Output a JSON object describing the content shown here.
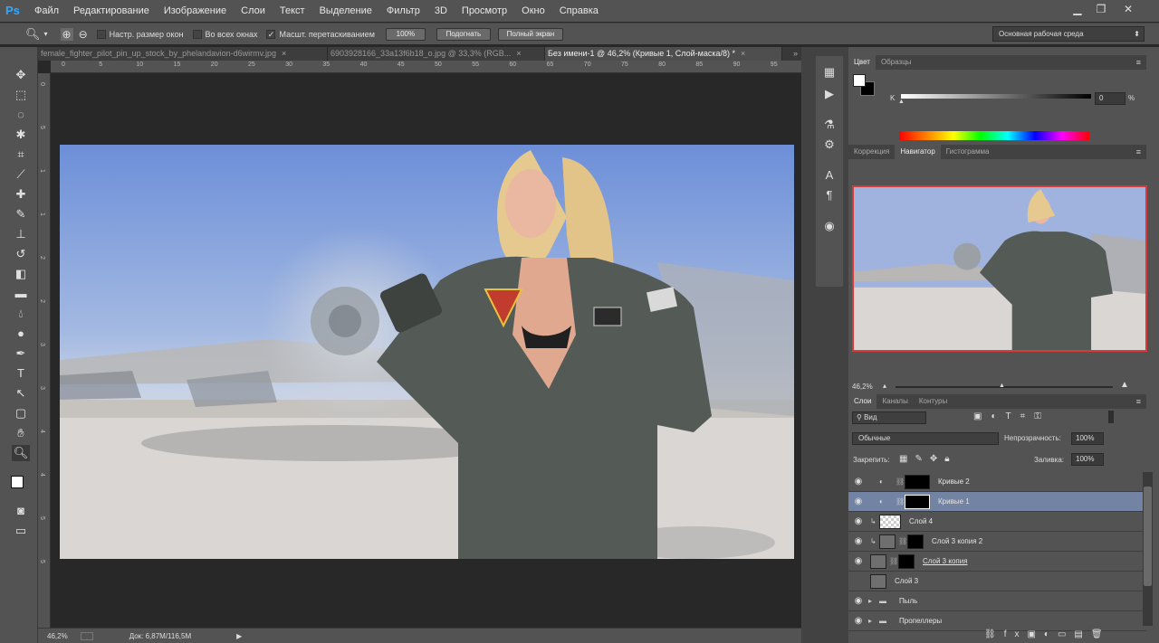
{
  "app": {
    "logo": "Ps"
  },
  "menu": [
    "Файл",
    "Редактирование",
    "Изображение",
    "Слои",
    "Текст",
    "Выделение",
    "Фильтр",
    "3D",
    "Просмотр",
    "Окно",
    "Справка"
  ],
  "options": {
    "resize_windows": "Настр. размер окон",
    "all_windows": "Во всех окнах",
    "scrubby_zoom": "Масшт. перетаскиванием",
    "zoom_100": "100%",
    "fit": "Подогнать",
    "full_screen": "Полный экран",
    "workspace": "Основная рабочая среда"
  },
  "tabs": [
    {
      "label": "female_fighter_pilot_pin_up_stock_by_phelandavion-d6wirmv.jpg"
    },
    {
      "label": "6903928166_33a13f6b18_o.jpg @ 33,3% (RGB..."
    },
    {
      "label": "Без имени-1 @ 46,2% (Кривые 1, Слой-маска/8) *",
      "active": true
    }
  ],
  "ruler_top": [
    "0",
    "5",
    "10",
    "15",
    "20",
    "25",
    "30",
    "35",
    "40",
    "45",
    "50",
    "55",
    "60",
    "65",
    "70",
    "75",
    "80",
    "85",
    "90",
    "95"
  ],
  "ruler_left": [
    "0",
    "5",
    "1",
    "1",
    "2",
    "2",
    "3",
    "3",
    "4",
    "4",
    "5",
    "5"
  ],
  "status": {
    "zoom": "46,2%",
    "doc": "Док: 6,87M/116,5M"
  },
  "color_panel": {
    "tabs": [
      "Цвет",
      "Образцы"
    ],
    "channel": "K",
    "value": "0",
    "unit": "%"
  },
  "navigator_panel": {
    "tabs": [
      "Коррекция",
      "Навигатор",
      "Гистограмма"
    ],
    "zoom": "46,2%"
  },
  "layers_panel": {
    "tabs": [
      "Слои",
      "Каналы",
      "Контуры"
    ],
    "filter": "Вид",
    "blend_mode": "Обычные",
    "opacity_label": "Непрозрачность:",
    "opacity": "100%",
    "lock_label": "Закрепить:",
    "fill_label": "Заливка:",
    "fill": "100%",
    "layers": [
      {
        "name": "Кривые 2"
      },
      {
        "name": "Кривые 1",
        "selected": true
      },
      {
        "name": "Слой 4"
      },
      {
        "name": "Слой 3 копия 2"
      },
      {
        "name": "Слой 3 копия"
      },
      {
        "name": "Слой 3"
      },
      {
        "name": "Пыль"
      },
      {
        "name": "Пропеллеры"
      }
    ]
  }
}
